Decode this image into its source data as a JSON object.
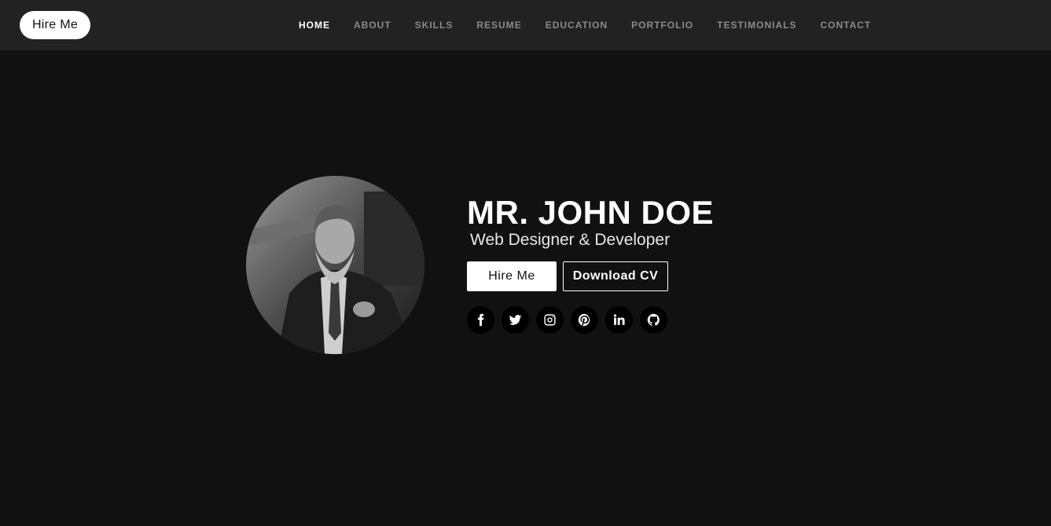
{
  "header": {
    "hire_button": "Hire Me",
    "nav": [
      {
        "label": "HOME",
        "active": true
      },
      {
        "label": "ABOUT"
      },
      {
        "label": "SKILLS"
      },
      {
        "label": "RESUME"
      },
      {
        "label": "EDUCATION"
      },
      {
        "label": "PORTFOLIO"
      },
      {
        "label": "TESTIMONIALS"
      },
      {
        "label": "CONTACT"
      }
    ]
  },
  "hero": {
    "name": "MR. JOHN DOE",
    "subtitle": "Web Designer & Developer",
    "hire_button": "Hire Me",
    "cv_button": "Download CV",
    "socials": [
      "facebook-icon",
      "twitter-icon",
      "instagram-icon",
      "pinterest-icon",
      "linkedin-icon",
      "github-icon"
    ]
  },
  "colors": {
    "background": "#111111",
    "header": "#222222",
    "nav_inactive": "#8a8a8a",
    "accent": "#ffffff"
  }
}
